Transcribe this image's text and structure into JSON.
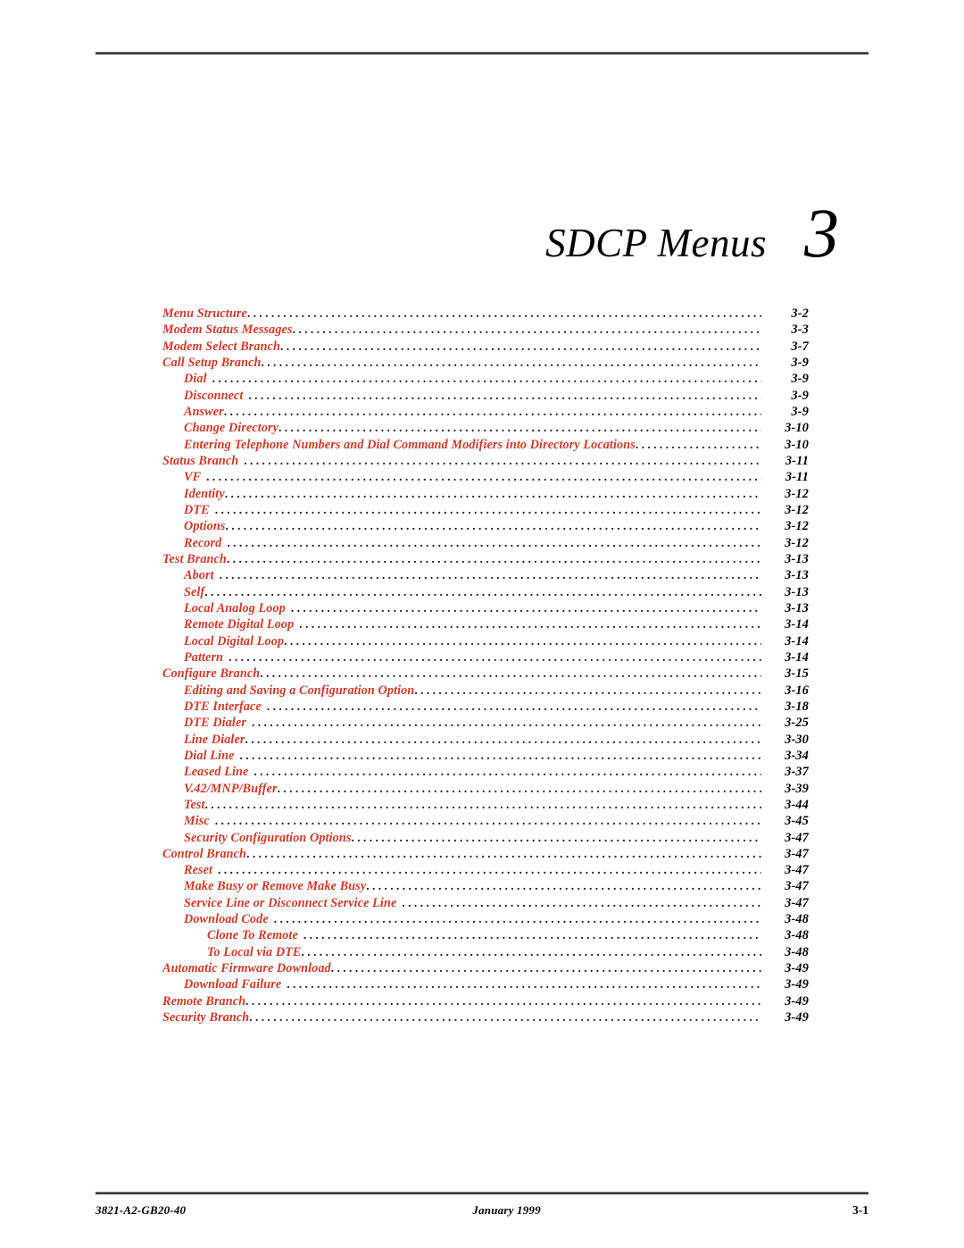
{
  "document": {
    "chapter_title": "SDCP Menus",
    "chapter_number": "3"
  },
  "toc": {
    "entries": [
      {
        "label": "Menu Structure",
        "page": "3-2",
        "level": 1,
        "gap": false
      },
      {
        "label": "Modem Status Messages",
        "page": "3-3",
        "level": 1,
        "gap": false
      },
      {
        "label": "Modem Select Branch",
        "page": "3-7",
        "level": 1,
        "gap": false
      },
      {
        "label": "Call Setup Branch",
        "page": "3-9",
        "level": 1,
        "gap": false
      },
      {
        "label": "Dial",
        "page": "3-9",
        "level": 2,
        "gap": true
      },
      {
        "label": "Disconnect",
        "page": "3-9",
        "level": 2,
        "gap": true
      },
      {
        "label": "Answer",
        "page": "3-9",
        "level": 2,
        "gap": false
      },
      {
        "label": "Change Directory",
        "page": "3-10",
        "level": 2,
        "gap": false
      },
      {
        "label": "Entering Telephone Numbers and Dial Command Modifiers into Directory Locations",
        "page": "3-10",
        "level": 2,
        "gap": false
      },
      {
        "label": "Status Branch",
        "page": "3-11",
        "level": 1,
        "gap": true
      },
      {
        "label": "VF",
        "page": "3-11",
        "level": 2,
        "gap": true
      },
      {
        "label": "Identity",
        "page": "3-12",
        "level": 2,
        "gap": false
      },
      {
        "label": "DTE",
        "page": "3-12",
        "level": 2,
        "gap": true
      },
      {
        "label": "Options",
        "page": "3-12",
        "level": 2,
        "gap": false
      },
      {
        "label": "Record",
        "page": "3-12",
        "level": 2,
        "gap": true
      },
      {
        "label": "Test Branch",
        "page": "3-13",
        "level": 1,
        "gap": false
      },
      {
        "label": "Abort",
        "page": "3-13",
        "level": 2,
        "gap": true
      },
      {
        "label": "Self",
        "page": "3-13",
        "level": 2,
        "gap": false
      },
      {
        "label": "Local Analog Loop",
        "page": "3-13",
        "level": 2,
        "gap": true
      },
      {
        "label": "Remote Digital Loop",
        "page": "3-14",
        "level": 2,
        "gap": true
      },
      {
        "label": "Local Digital Loop",
        "page": "3-14",
        "level": 2,
        "gap": false
      },
      {
        "label": "Pattern",
        "page": "3-14",
        "level": 2,
        "gap": true
      },
      {
        "label": "Configure Branch",
        "page": "3-15",
        "level": 1,
        "gap": false
      },
      {
        "label": "Editing and Saving a Configuration Option",
        "page": "3-16",
        "level": 2,
        "gap": false
      },
      {
        "label": "DTE Interface",
        "page": "3-18",
        "level": 2,
        "gap": true
      },
      {
        "label": "DTE Dialer",
        "page": "3-25",
        "level": 2,
        "gap": true
      },
      {
        "label": "Line Dialer",
        "page": "3-30",
        "level": 2,
        "gap": false
      },
      {
        "label": "Dial Line",
        "page": "3-34",
        "level": 2,
        "gap": true
      },
      {
        "label": "Leased Line",
        "page": "3-37",
        "level": 2,
        "gap": true
      },
      {
        "label": "V.42/MNP/Buffer",
        "page": "3-39",
        "level": 2,
        "gap": false
      },
      {
        "label": "Test",
        "page": "3-44",
        "level": 2,
        "gap": false
      },
      {
        "label": "Misc",
        "page": "3-45",
        "level": 2,
        "gap": true
      },
      {
        "label": "Security Configuration Options",
        "page": "3-47",
        "level": 2,
        "gap": false
      },
      {
        "label": "Control Branch",
        "page": "3-47",
        "level": 1,
        "gap": false
      },
      {
        "label": "Reset",
        "page": "3-47",
        "level": 2,
        "gap": true
      },
      {
        "label": "Make Busy or Remove Make Busy",
        "page": "3-47",
        "level": 2,
        "gap": false
      },
      {
        "label": "Service Line or Disconnect Service Line",
        "page": "3-47",
        "level": 2,
        "gap": true
      },
      {
        "label": "Download Code",
        "page": "3-48",
        "level": 2,
        "gap": true
      },
      {
        "label": "Clone To Remote",
        "page": "3-48",
        "level": 3,
        "gap": true
      },
      {
        "label": "To Local via DTE",
        "page": "3-48",
        "level": 3,
        "gap": false
      },
      {
        "label": "Automatic Firmware Download",
        "page": "3-49",
        "level": 1,
        "gap": false
      },
      {
        "label": "Download Failure",
        "page": "3-49",
        "level": 2,
        "gap": true
      },
      {
        "label": "Remote Branch",
        "page": "3-49",
        "level": 1,
        "gap": false
      },
      {
        "label": "Security Branch",
        "page": "3-49",
        "level": 1,
        "gap": false
      }
    ]
  },
  "footer": {
    "part_number": "3821-A2-GB20-40",
    "date": "January 1999",
    "page_number": "3-1"
  }
}
